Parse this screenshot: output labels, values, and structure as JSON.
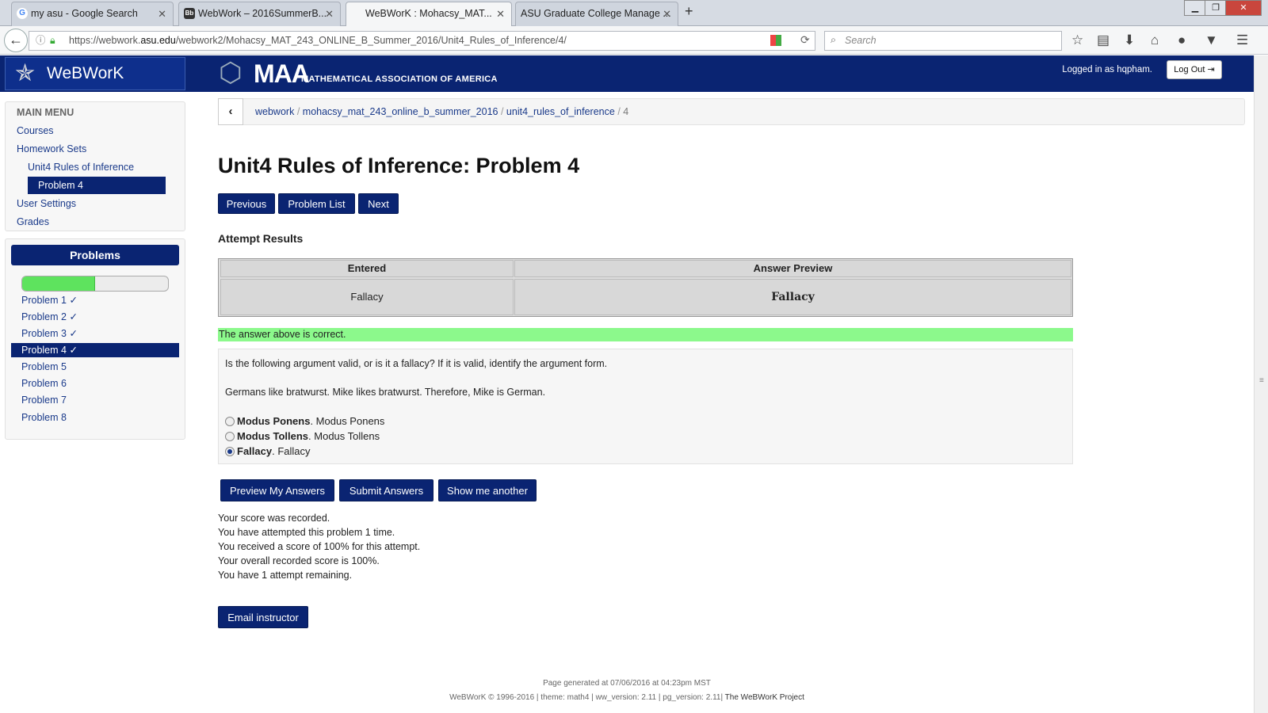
{
  "browser": {
    "tabs": [
      {
        "label": "my asu - Google Search",
        "icon": "G"
      },
      {
        "label": "WebWork – 2016SummerB...",
        "icon": "Bb"
      },
      {
        "label": "WeBWorK : Mohacsy_MAT...",
        "icon": ""
      },
      {
        "label": "ASU Graduate College Manage ...",
        "icon": ""
      }
    ],
    "new_tab": "+",
    "url_prefix": "https://webwork.",
    "url_domain": "asu.edu",
    "url_rest": "/webwork2/Mohacsy_MAT_243_ONLINE_B_Summer_2016/Unit4_Rules_of_Inference/4/",
    "search_placeholder": "Search"
  },
  "header": {
    "brand": "WeBWorK",
    "maa_short": "MAA",
    "maa_long": "MATHEMATICAL ASSOCIATION OF AMERICA",
    "logged_in": "Logged in as hqpham.",
    "logout": "Log Out"
  },
  "menu": {
    "heading": "MAIN MENU",
    "items": [
      "Courses",
      "Homework Sets",
      "Unit4 Rules of Inference",
      "Problem 4",
      "User Settings",
      "Grades"
    ]
  },
  "problems": {
    "heading": "Problems",
    "progress_fraction": 0.5,
    "items": [
      "Problem 1 ✓",
      "Problem 2 ✓",
      "Problem 3 ✓",
      "Problem 4 ✓",
      "Problem 5",
      "Problem 6",
      "Problem 7",
      "Problem 8"
    ]
  },
  "breadcrumb": {
    "items": [
      "webwork",
      "mohacsy_mat_243_online_b_summer_2016",
      "unit4_rules_of_inference"
    ],
    "last": "4",
    "sep": "/"
  },
  "page": {
    "title": "Unit4 Rules of Inference: Problem 4",
    "buttons": {
      "previous": "Previous",
      "list": "Problem List",
      "next": "Next"
    },
    "attempt_heading": "Attempt Results",
    "table": {
      "col1": "Entered",
      "col2": "Answer Preview",
      "entered": "Fallacy",
      "preview": "Fallacy"
    },
    "correct_msg": "The answer above is correct.",
    "question": "Is the following argument valid, or is it a fallacy? If it is valid, identify the argument form.",
    "argument": "Germans like bratwurst. Mike likes bratwurst. Therefore, Mike is German.",
    "options": [
      {
        "bold": "Modus Ponens",
        "rest": ". Modus Ponens",
        "selected": false
      },
      {
        "bold": "Modus Tollens",
        "rest": ". Modus Tollens",
        "selected": false
      },
      {
        "bold": "Fallacy",
        "rest": ". Fallacy",
        "selected": true
      }
    ],
    "actions": {
      "preview": "Preview My Answers",
      "submit": "Submit Answers",
      "another": "Show me another"
    },
    "score_lines": [
      "Your score was recorded.",
      "You have attempted this problem 1 time.",
      "You received a score of 100% for this attempt.",
      "Your overall recorded score is 100%.",
      "You have 1 attempt remaining."
    ],
    "email": "Email instructor"
  },
  "footer": {
    "line1": "Page generated at 07/06/2016 at 04:23pm MST",
    "line2": "WeBWorK © 1996-2016 | theme: math4 | ww_version: 2.11 | pg_version: 2.11|",
    "project": "The WeBWorK Project"
  }
}
